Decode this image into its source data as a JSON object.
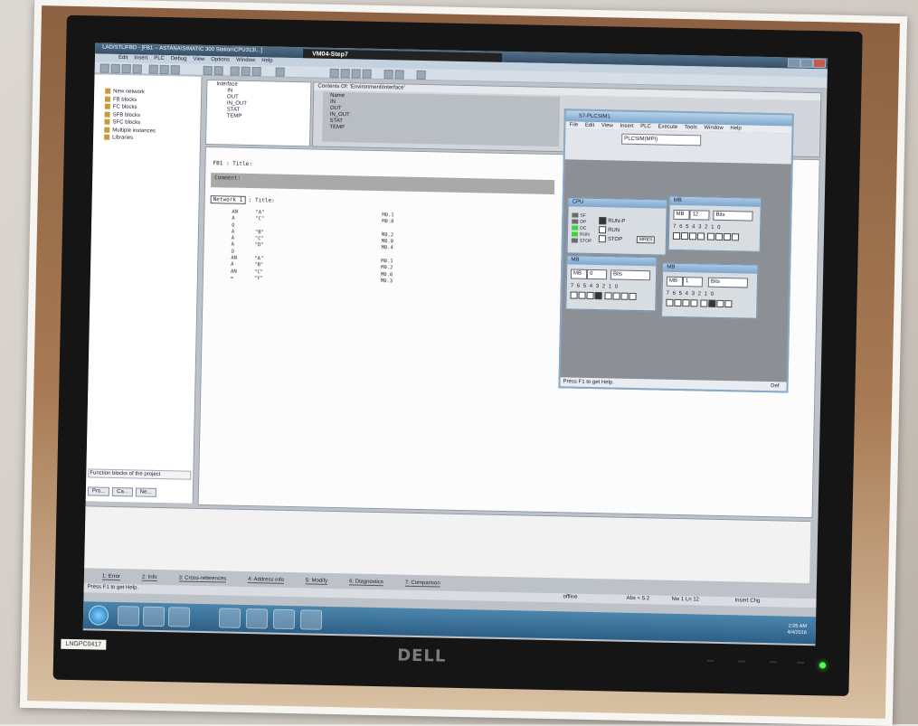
{
  "step7": {
    "window_title": "LAD/STL/FBD - [FB1 -- ASTANA\\SIMATIC 300 Station\\CPU313\\...]",
    "tab_title": "VM04-Step7",
    "menu": [
      "Edit",
      "Insert",
      "PLC",
      "Debug",
      "View",
      "Options",
      "Window",
      "Help"
    ],
    "tree": [
      "New network",
      "FB blocks",
      "FC blocks",
      "SFB blocks",
      "SFC blocks",
      "Multiple instances",
      "Libraries"
    ],
    "left_caption": "Function blocks of the project",
    "left_tabs": [
      "Pro...",
      "Ca...",
      "Ne..."
    ],
    "interface_tree": {
      "root": "Interface",
      "items": [
        "IN",
        "OUT",
        "IN_OUT",
        "STAT",
        "TEMP"
      ]
    },
    "declaration": {
      "header": "Contents Of: 'Environment\\Interface'",
      "col": "Name",
      "rows": [
        "IN",
        "OUT",
        "IN_OUT",
        "STAT",
        "TEMP"
      ]
    },
    "fc_title": "FB1 : Title:",
    "comment": "Comment:",
    "network_label": "Network 1",
    "network_title": ": Title:",
    "stl": [
      {
        "op": "AN",
        "addr": "\"A\"",
        "mem": "M0.1"
      },
      {
        "op": "A",
        "addr": "\"C\"",
        "mem": "M0.0"
      },
      {
        "op": "O",
        "addr": "",
        "mem": ""
      },
      {
        "op": "A",
        "addr": "\"B\"",
        "mem": "M0.2"
      },
      {
        "op": "A",
        "addr": "\"C\"",
        "mem": "M0.0"
      },
      {
        "op": "A",
        "addr": "\"D\"",
        "mem": "M0.4"
      },
      {
        "op": "O",
        "addr": "",
        "mem": ""
      },
      {
        "op": "AN",
        "addr": "\"A\"",
        "mem": "M0.1"
      },
      {
        "op": "A",
        "addr": "\"B\"",
        "mem": "M0.2"
      },
      {
        "op": "AN",
        "addr": "\"C\"",
        "mem": "M0.0"
      },
      {
        "op": "=",
        "addr": "\"Y\"",
        "mem": "M0.3"
      }
    ],
    "message_tabs": [
      "1: Error",
      "2: Info",
      "3: Cross-references",
      "4: Address info",
      "5: Modify",
      "6: Diagnostics",
      "7: Comparison"
    ],
    "status": {
      "help": "Press F1 to get Help.",
      "mode": "offline",
      "abs": "Abs < 5.2",
      "pos": "Nw 1  Ln 12",
      "insert": "Insert  Chg"
    },
    "clock": {
      "time": "2:05 AM",
      "date": "4/4/2016"
    }
  },
  "plcsim": {
    "title": "S7-PLCSIM1",
    "menu": [
      "File",
      "Edit",
      "View",
      "Insert",
      "PLC",
      "Execute",
      "Tools",
      "Window",
      "Help"
    ],
    "combo": "PLCSIM(MPI)",
    "help": "Press F1 to get Help.",
    "net": "Def",
    "cpu": {
      "title": "CPU",
      "leds": [
        "SF",
        "DP",
        "DC",
        "RUN",
        "STOP"
      ],
      "opt_runp": "RUN-P",
      "opt_run": "RUN",
      "opt_stop": "STOP",
      "mres": "MRES"
    },
    "mb": [
      {
        "title": "MB",
        "addr": "MB",
        "num": "12",
        "fmt": "Bits",
        "bits": "7 6 5 4    3 2 1 0"
      },
      {
        "title": "MB",
        "addr": "MB",
        "num": "0",
        "fmt": "Bits",
        "bits": "7 6 5 4    3 2 1 0"
      },
      {
        "title": "MB",
        "addr": "MB",
        "num": "1",
        "fmt": "Bits",
        "bits": "7 6 5 4    3 2 1 0"
      }
    ]
  },
  "monitor": {
    "brand": "DELL",
    "asset_tag": "LNGPC0417"
  }
}
